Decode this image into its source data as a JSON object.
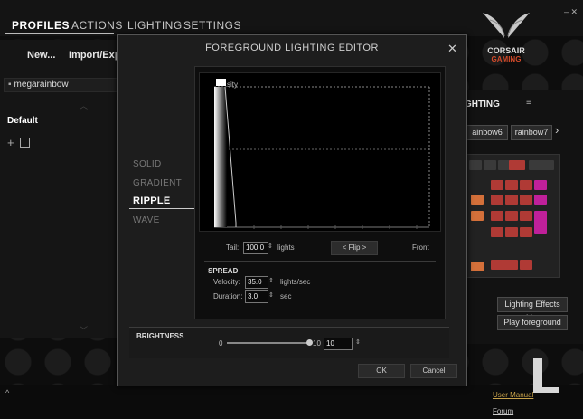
{
  "nav": {
    "tabs": [
      "PROFILES",
      "ACTIONS",
      "LIGHTING",
      "SETTINGS"
    ]
  },
  "left": {
    "new_label": "New...",
    "import_label": "Import/Exp",
    "profile_name": "megarainbow",
    "default_label": "Default"
  },
  "brand": {
    "line1": "CORSAIR",
    "line2": "GAMING"
  },
  "right": {
    "lighting_label": "GHTING",
    "chips": [
      "ainbow6",
      "rainbow7"
    ],
    "effects_list_label": "Lighting Effects List",
    "play_label": "Play foreground"
  },
  "footer": {
    "user_manual": "User Manual",
    "forum": "Forum",
    "corner": "^"
  },
  "dialog": {
    "title": "FOREGROUND LIGHTING EDITOR",
    "close": "✕",
    "modes": [
      "SOLID",
      "GRADIENT",
      "RIPPLE",
      "WAVE"
    ],
    "active_mode": "RIPPLE",
    "graph_label": "sity",
    "tail_label": "Tail:",
    "tail_value": "100.0",
    "tail_unit": "lights",
    "flip_label": "< Flip >",
    "front_label": "Front",
    "spread_label": "SPREAD",
    "velocity_label": "Velocity:",
    "velocity_value": "35.0",
    "velocity_unit": "lights/sec",
    "duration_label": "Duration:",
    "duration_value": "3.0",
    "duration_unit": "sec",
    "brightness_label": "BRIGHTNESS",
    "brightness_min": "0",
    "brightness_max": "10",
    "brightness_value": "10",
    "ok_label": "OK",
    "cancel_label": "Cancel"
  },
  "colors": {
    "accent": "#c8a24a",
    "key_red": "#b03a35",
    "key_pink": "#c0209a"
  }
}
